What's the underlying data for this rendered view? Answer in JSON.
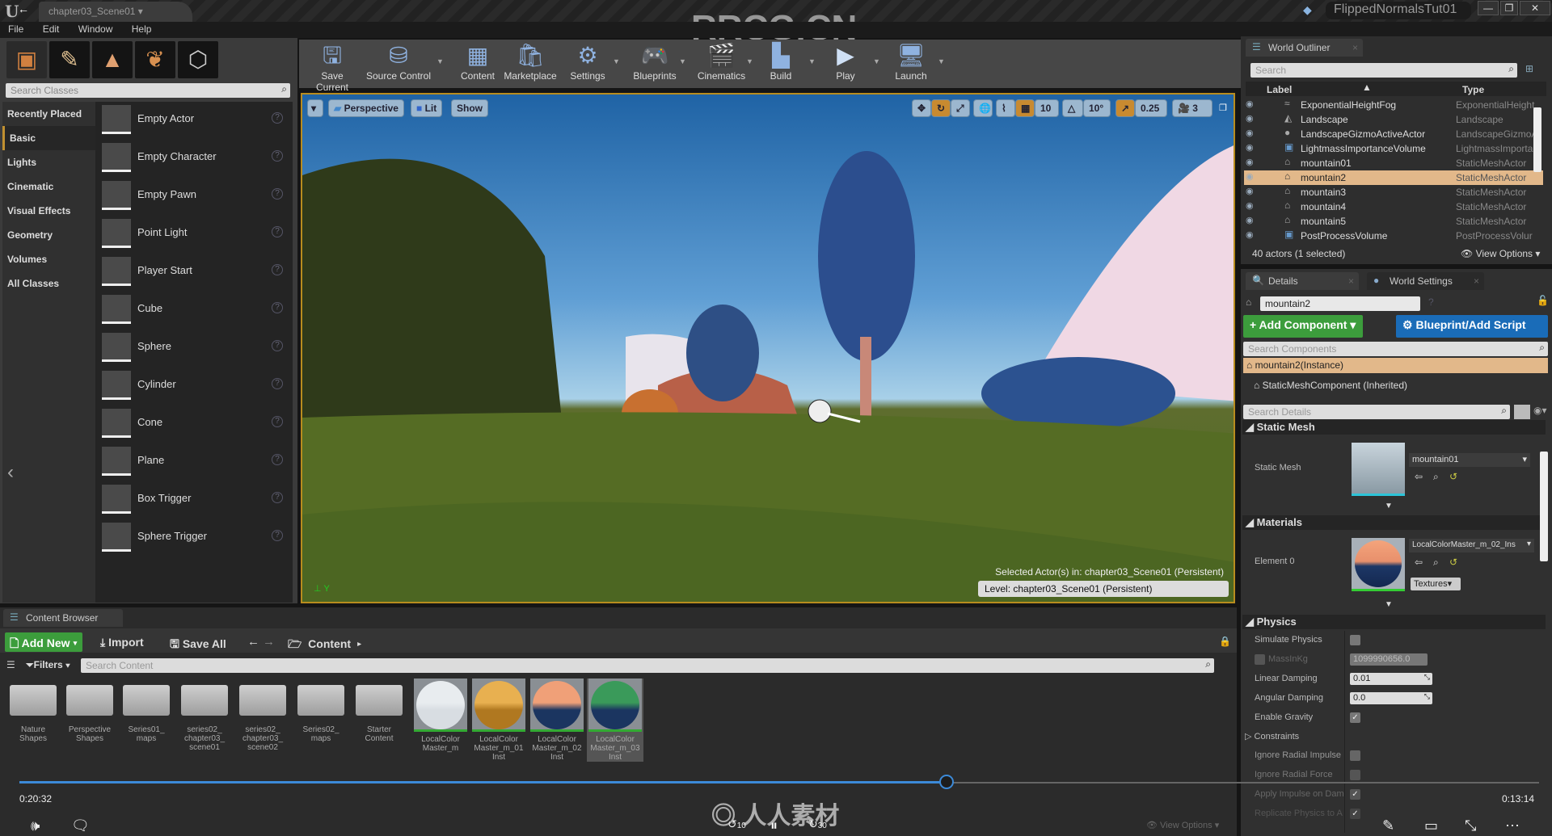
{
  "window": {
    "document_tab": "chapter03_Scene01",
    "project_name": "FlippedNormalsTut01",
    "controls": [
      "minimize",
      "maximize",
      "close"
    ]
  },
  "menu": [
    "File",
    "Edit",
    "Window",
    "Help"
  ],
  "modes": {
    "tabs": [
      "place-mode",
      "paint-mode",
      "landscape-mode",
      "foliage-mode",
      "geometry-mode"
    ],
    "search_placeholder": "Search Classes",
    "categories": [
      "Recently Placed",
      "Basic",
      "Lights",
      "Cinematic",
      "Visual Effects",
      "Geometry",
      "Volumes",
      "All Classes"
    ],
    "selected_category": "Basic",
    "items": [
      "Empty Actor",
      "Empty Character",
      "Empty Pawn",
      "Point Light",
      "Player Start",
      "Cube",
      "Sphere",
      "Cylinder",
      "Cone",
      "Plane",
      "Box Trigger",
      "Sphere Trigger"
    ]
  },
  "toolbar": {
    "buttons": [
      {
        "label": "Save Current",
        "icon": "floppy-icon"
      },
      {
        "label": "Source Control",
        "icon": "source-control-icon"
      },
      {
        "label": "Content",
        "icon": "content-icon"
      },
      {
        "label": "Marketplace",
        "icon": "marketplace-icon"
      },
      {
        "label": "Settings",
        "icon": "gear-icon"
      },
      {
        "label": "Blueprints",
        "icon": "gamepad-icon"
      },
      {
        "label": "Cinematics",
        "icon": "clapper-icon"
      },
      {
        "label": "Build",
        "icon": "build-icon"
      },
      {
        "label": "Play",
        "icon": "play-icon"
      },
      {
        "label": "Launch",
        "icon": "launch-icon"
      }
    ]
  },
  "viewport": {
    "view_mode": "Perspective",
    "lighting": "Lit",
    "show": "Show",
    "grid_snap": "10",
    "rotation_snap": "10°",
    "scale_snap": "0.25",
    "camera_speed": "3",
    "selected_actor_text": "Selected Actor(s) in:  chapter03_Scene01 (Persistent)",
    "level_text": "Level:  chapter03_Scene01 (Persistent)",
    "axis_label": "Y"
  },
  "outliner": {
    "tab": "World Outliner",
    "search_placeholder": "Search",
    "col_label": "Label",
    "col_type": "Type",
    "rows": [
      {
        "label": "ExponentialHeightFog",
        "type": "ExponentialHeight"
      },
      {
        "label": "Landscape",
        "type": "Landscape"
      },
      {
        "label": "LandscapeGizmoActiveActor",
        "type": "LandscapeGizmoA"
      },
      {
        "label": "LightmassImportanceVolume",
        "type": "LightmassImporta"
      },
      {
        "label": "mountain01",
        "type": "StaticMeshActor"
      },
      {
        "label": "mountain2",
        "type": "StaticMeshActor",
        "selected": true
      },
      {
        "label": "mountain3",
        "type": "StaticMeshActor"
      },
      {
        "label": "mountain4",
        "type": "StaticMeshActor"
      },
      {
        "label": "mountain5",
        "type": "StaticMeshActor"
      },
      {
        "label": "PostProcessVolume",
        "type": "PostProcessVolur"
      }
    ],
    "status": "40 actors (1 selected)",
    "view_options": "View Options"
  },
  "details": {
    "tab": "Details",
    "tab2": "World Settings",
    "actor_name": "mountain2",
    "add_component": "+ Add Component",
    "blueprint": "Blueprint/Add Script",
    "search_components_placeholder": "Search Components",
    "components": [
      "mountain2(Instance)",
      "StaticMeshComponent (Inherited)"
    ],
    "search_details_placeholder": "Search Details",
    "static_mesh_section": "Static Mesh",
    "static_mesh_label": "Static Mesh",
    "static_mesh_value": "mountain01",
    "materials_section": "Materials",
    "element_label": "Element 0",
    "material_value": "LocalColorMaster_m_02_Ins",
    "textures_button": "Textures",
    "physics_section": "Physics",
    "physics": {
      "simulate_physics": {
        "label": "Simulate Physics",
        "checked": false
      },
      "mass": {
        "label": "MassInKg",
        "value": "1099990656.0"
      },
      "linear_damping": {
        "label": "Linear Damping",
        "value": "0.01"
      },
      "angular_damping": {
        "label": "Angular Damping",
        "value": "0.0"
      },
      "enable_gravity": {
        "label": "Enable Gravity",
        "checked": true
      },
      "constraints": "Constraints",
      "ignore_radial_impulse": {
        "label": "Ignore Radial Impulse",
        "checked": false
      },
      "ignore_radial_force": {
        "label": "Ignore Radial Force",
        "checked": false
      },
      "apply_impulse": {
        "label": "Apply Impulse on Dam",
        "checked": true
      },
      "replicate_physics": {
        "label": "Replicate Physics to A",
        "checked": true
      }
    }
  },
  "content_browser": {
    "tab": "Content Browser",
    "add_new": "Add New",
    "import": "Import",
    "save_all": "Save All",
    "path": "Content",
    "filters": "Filters",
    "search_placeholder": "Search Content",
    "view_options": "View Options",
    "folders": [
      "Nature Shapes",
      "Perspective Shapes",
      "Series01_ maps",
      "series02_ chapter03_ scene01",
      "series02_ chapter03_ scene02",
      "Series02_ maps",
      "Starter Content"
    ],
    "materials": [
      {
        "name": "LocalColor Master_m",
        "top": "#e8ecef",
        "bottom": "#d8dde2"
      },
      {
        "name": "LocalColor Master_m_01 Inst",
        "top": "#e8b050",
        "bottom": "#b07820"
      },
      {
        "name": "LocalColor Master_m_02 Inst",
        "top": "#f0a078",
        "bottom": "#1b3560"
      },
      {
        "name": "LocalColor Master_m_03 Inst",
        "top": "#3a9a5a",
        "bottom": "#1b3560"
      }
    ]
  },
  "video": {
    "elapsed": "0:20:32",
    "remaining": "0:13:14",
    "progress": 0.61,
    "skip_back": "10",
    "skip_forward": "30",
    "watermark": "人人素材",
    "top_watermark": "RRCG.CN"
  }
}
